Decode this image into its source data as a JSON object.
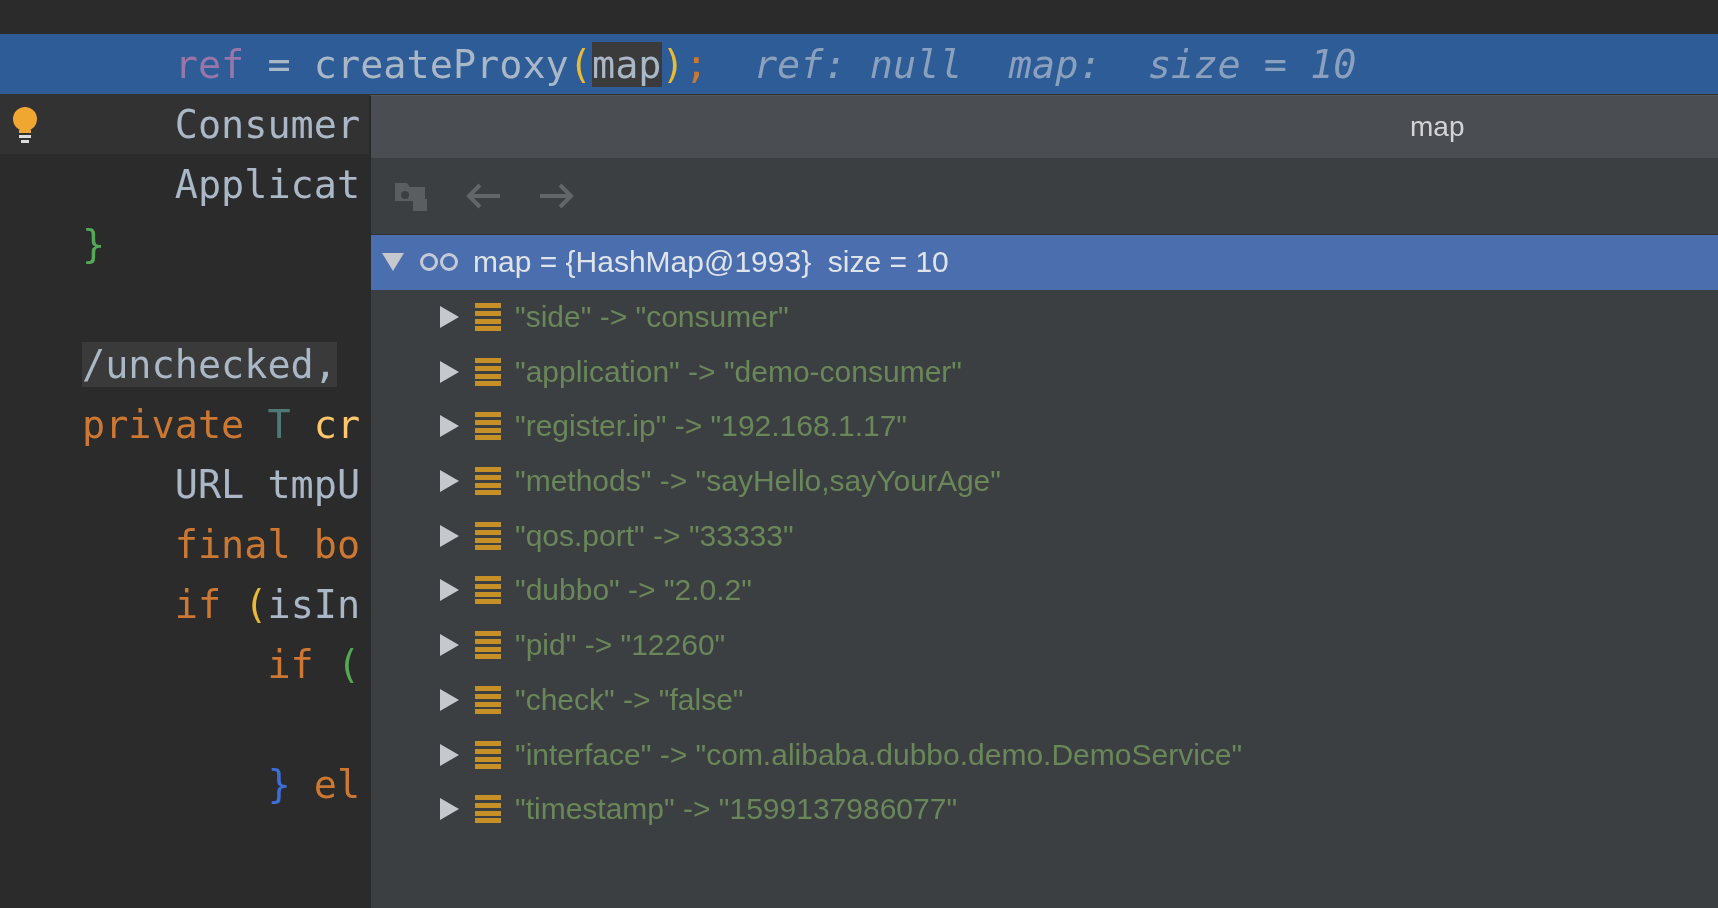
{
  "editor": {
    "lines": [
      {
        "kind": "blank"
      },
      {
        "kind": "code",
        "execution": true,
        "tokens": [
          {
            "text": "    ref",
            "kind": "field"
          },
          {
            "text": " = createProxy",
            "kind": "plain"
          },
          {
            "text": "(",
            "kind": "paren"
          },
          {
            "text": "map",
            "kind": "usage"
          },
          {
            "text": ")",
            "kind": "paren"
          },
          {
            "text": ";",
            "kind": "keyword"
          }
        ],
        "hint": "ref: null  map:  size = 10"
      },
      {
        "kind": "code",
        "current": true,
        "bulb": true,
        "tokens": [
          {
            "text": "    Consumer",
            "kind": "plain"
          }
        ]
      },
      {
        "kind": "code",
        "tokens": [
          {
            "text": "    Applicat",
            "kind": "plain"
          }
        ]
      },
      {
        "kind": "code",
        "tokens": [
          {
            "text": "}",
            "kind": "brace"
          }
        ]
      },
      {
        "kind": "blank"
      },
      {
        "kind": "code",
        "tokens": [
          {
            "text": "/unchecked,",
            "kind": "folded"
          }
        ]
      },
      {
        "kind": "code",
        "tokens": [
          {
            "text": "private",
            "kind": "keyword"
          },
          {
            "text": " T",
            "kind": "typeparam"
          },
          {
            "text": " cr",
            "kind": "method"
          }
        ]
      },
      {
        "kind": "code",
        "tokens": [
          {
            "text": "    URL tmpU",
            "kind": "plain"
          }
        ]
      },
      {
        "kind": "code",
        "tokens": [
          {
            "text": "    final bo",
            "kind": "keyword"
          }
        ]
      },
      {
        "kind": "code",
        "tokens": [
          {
            "text": "    if ",
            "kind": "keyword"
          },
          {
            "text": "(",
            "kind": "paren"
          },
          {
            "text": "isIn",
            "kind": "plain"
          }
        ]
      },
      {
        "kind": "code",
        "tokens": [
          {
            "text": "        if ",
            "kind": "keyword"
          },
          {
            "text": "(",
            "kind": "brace"
          }
        ]
      },
      {
        "kind": "blank"
      },
      {
        "kind": "code",
        "tokens": [
          {
            "text": "        }",
            "kind": "block"
          },
          {
            "text": " el",
            "kind": "keyword"
          }
        ]
      },
      {
        "kind": "blank"
      }
    ]
  },
  "popup": {
    "title": "map",
    "toolbar": [
      {
        "kind": "jump",
        "disabled": true
      },
      {
        "kind": "back",
        "disabled": true
      },
      {
        "kind": "forward",
        "disabled": true
      }
    ],
    "tree": {
      "label": "map = {HashMap@1993}  size = 10",
      "expanded": true,
      "selected": true,
      "children": [
        {
          "label": "\"side\" -> \"consumer\"",
          "expanded": false,
          "selected": false
        },
        {
          "label": "\"application\" -> \"demo-consumer\"",
          "expanded": false,
          "selected": false
        },
        {
          "label": "\"register.ip\" -> \"192.168.1.17\"",
          "expanded": false,
          "selected": false
        },
        {
          "label": "\"methods\" -> \"sayHello,sayYourAge\"",
          "expanded": false,
          "selected": false
        },
        {
          "label": "\"qos.port\" -> \"33333\"",
          "expanded": false,
          "selected": false
        },
        {
          "label": "\"dubbo\" -> \"2.0.2\"",
          "expanded": false,
          "selected": false
        },
        {
          "label": "\"pid\" -> \"12260\"",
          "expanded": false,
          "selected": false
        },
        {
          "label": "\"check\" -> \"false\"",
          "expanded": false,
          "selected": false
        },
        {
          "label": "\"interface\" -> \"com.alibaba.dubbo.demo.DemoService\"",
          "expanded": false,
          "selected": false
        },
        {
          "label": "\"timestamp\" -> \"1599137986077\"",
          "expanded": false,
          "selected": false
        }
      ]
    }
  }
}
